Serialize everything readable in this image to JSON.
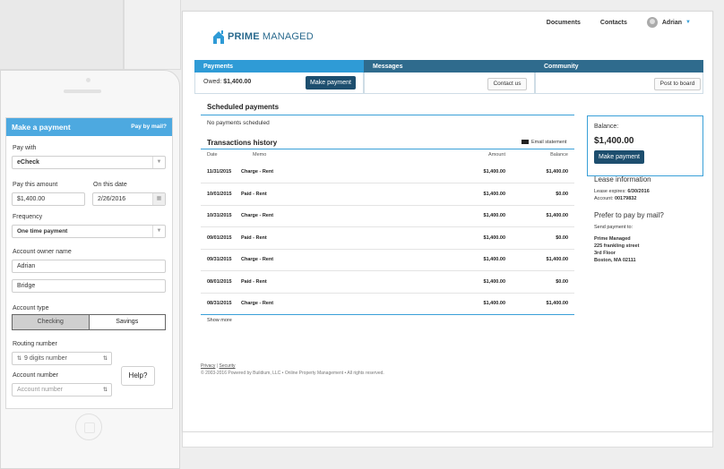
{
  "colors": {
    "accent": "#3aa0d8",
    "brand_dark": "#1d4e6e",
    "tab_blue": "#2f9bd6",
    "tab_navy": "#2f6b8d"
  },
  "brand": {
    "bold": "PRIME",
    "light": "MANAGED"
  },
  "topnav": {
    "documents": "Documents",
    "contacts": "Contacts",
    "user": "Adrian"
  },
  "tabs": [
    {
      "label": "Payments",
      "action": "Make payment"
    },
    {
      "label": "Messages",
      "action": "Contact us"
    },
    {
      "label": "Community",
      "action": "Post to board"
    }
  ],
  "owed": {
    "label": "Owed:",
    "value": "$1,400.00"
  },
  "scheduled": {
    "title": "Scheduled payments",
    "empty": "No payments scheduled"
  },
  "history": {
    "title": "Transactions history",
    "email": "Email statement",
    "columns": {
      "date": "Date",
      "memo": "Memo",
      "amount": "Amount",
      "balance": "Balance"
    },
    "rows": [
      {
        "date": "11/31/2015",
        "memo": "Charge - Rent",
        "amount": "$1,400.00",
        "balance": "$1,400.00"
      },
      {
        "date": "10/01/2015",
        "memo": "Paid - Rent",
        "amount": "$1,400.00",
        "balance": "$0.00"
      },
      {
        "date": "10/31/2015",
        "memo": "Charge - Rent",
        "amount": "$1,400.00",
        "balance": "$1,400.00"
      },
      {
        "date": "09/01/2015",
        "memo": "Paid - Rent",
        "amount": "$1,400.00",
        "balance": "$0.00"
      },
      {
        "date": "09/31/2015",
        "memo": "Charge - Rent",
        "amount": "$1,400.00",
        "balance": "$1,400.00"
      },
      {
        "date": "08/01/2015",
        "memo": "Paid - Rent",
        "amount": "$1,400.00",
        "balance": "$0.00"
      },
      {
        "date": "08/31/2015",
        "memo": "Charge - Rent",
        "amount": "$1,400.00",
        "balance": "$1,400.00"
      }
    ],
    "more": "Show more"
  },
  "balance": {
    "label": "Balance:",
    "value": "$1,400.00",
    "button": "Make payment"
  },
  "lease": {
    "title": "Lease information",
    "expires_label": "Lease expires:",
    "expires": "6/30/2016",
    "account_label": "Account:",
    "account": "00179832"
  },
  "mail": {
    "title": "Prefer to pay by mail?",
    "send": "Send payment to:",
    "address": [
      "Prime Managed",
      "225 frankling street",
      "3rd Floor",
      "Boston, MA 02111"
    ]
  },
  "footer": {
    "privacy": "Privacy",
    "sep": " | ",
    "security": "Security",
    "copy": "© 2003-2016 Powered by Buildium, LLC • Online Property Management • All rights reserved."
  },
  "mobile": {
    "title": "Make a payment",
    "by_mail": "Pay by mail?",
    "pay_with_label": "Pay with",
    "pay_with": "eCheck",
    "amount_label": "Pay this amount",
    "amount": "$1,400.00",
    "date_label": "On this date",
    "date": "2/26/2016",
    "frequency_label": "Frequency",
    "frequency": "One time payment",
    "owner_label": "Account owner name",
    "first_name": "Adrian",
    "last_name": "Bridge",
    "type_label": "Account type",
    "type_checking": "Checking",
    "type_savings": "Savings",
    "routing_label": "Routing number",
    "routing_placeholder": "9 digits number",
    "account_label": "Account number",
    "account_placeholder": "Account number",
    "help": "Help?"
  }
}
